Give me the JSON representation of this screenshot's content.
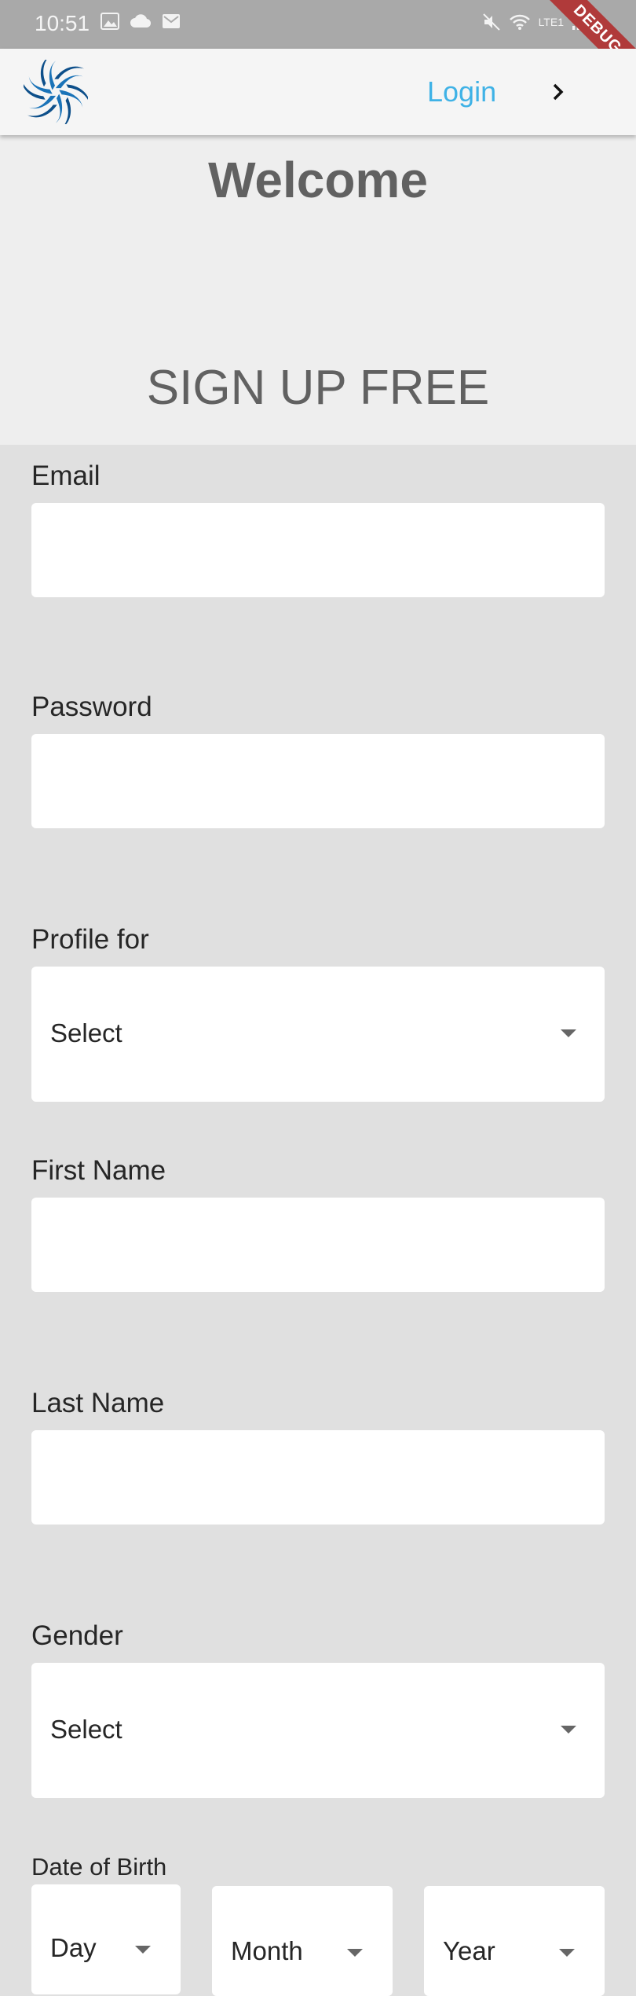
{
  "status_bar": {
    "time": "10:51",
    "debug_label": "DEBUG",
    "lte_label": "LTE1"
  },
  "app_bar": {
    "login_label": "Login"
  },
  "hero": {
    "welcome": "Welcome",
    "signup": "SIGN UP FREE"
  },
  "form": {
    "email_label": "Email",
    "email_value": "",
    "password_label": "Password",
    "password_value": "",
    "profile_for_label": "Profile for",
    "profile_for_value": "Select",
    "first_name_label": "First Name",
    "first_name_value": "",
    "last_name_label": "Last Name",
    "last_name_value": "",
    "gender_label": "Gender",
    "gender_value": "Select",
    "dob_label": "Date of Birth",
    "dob_day": "Day",
    "dob_month": "Month",
    "dob_year": "Year"
  },
  "colors": {
    "status_bar": "#a9a9a9",
    "app_bar": "#f5f5f5",
    "login_link": "#3fb2e6",
    "hero_background": "#eeeeee",
    "form_background": "#e0e0e0",
    "heading_text": "#616161",
    "debug_ribbon": "#b03a3a",
    "logo": "#1a73b8"
  },
  "icons": {
    "logo": "swirl-logo-icon",
    "chevron": "chevron-right-icon",
    "dropdown": "arrow-drop-down-icon"
  }
}
